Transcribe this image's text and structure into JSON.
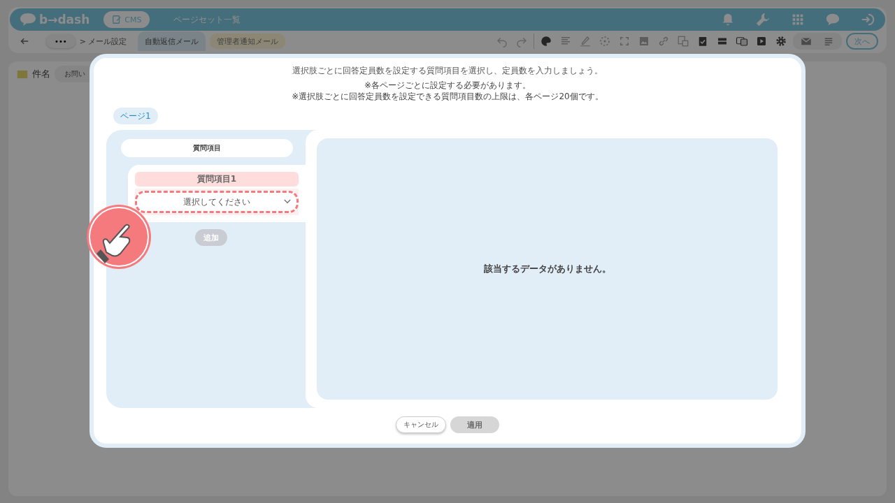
{
  "app_header": {
    "logo": "b→dash",
    "cms_button": "CMS",
    "title": "ページセット一覧"
  },
  "toolbar": {
    "more_button": "•••",
    "breadcrumb": "> メール設定",
    "tabs": [
      {
        "label": "自動返信メール",
        "selected": true
      },
      {
        "label": "管理者通知メール",
        "selected": false
      }
    ],
    "next_button": "次へ"
  },
  "subject": {
    "label": "件名",
    "value": "お問い"
  },
  "dialog": {
    "instruction": "選択肢ごとに回答定員数を設定する質問項目を選択し、定員数を入力しましょう。",
    "notes": [
      "※各ページごとに設定する必要があります。",
      "※選択肢ごとに回答定員数を設定できる質問項目数の上限は、各ページ20個です。"
    ],
    "page_tabs": [
      {
        "label": "ページ1",
        "selected": true
      }
    ],
    "column_header": "質問項目",
    "questions": [
      {
        "title": "質問項目1",
        "placeholder": "選択してください",
        "highlighted": true
      }
    ],
    "add_button": {
      "label": "追加",
      "disabled": true
    },
    "empty_message": "該当するデータがありません。",
    "cancel_button": "キャンセル",
    "apply_button": {
      "label": "適用",
      "disabled": true
    }
  }
}
